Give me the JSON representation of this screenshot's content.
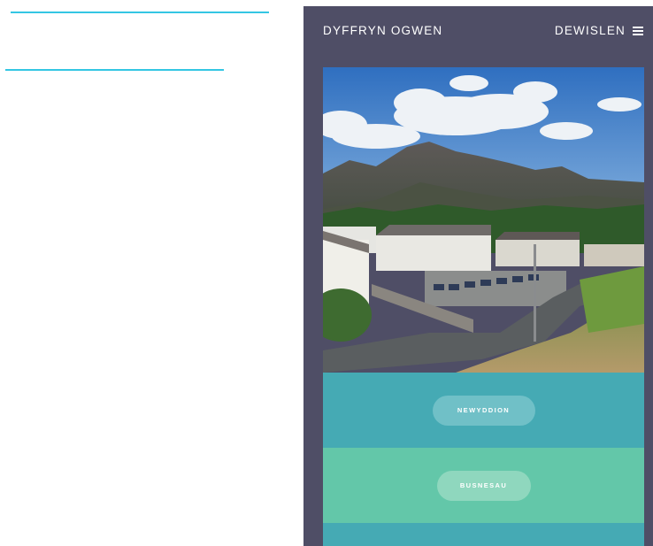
{
  "header": {
    "site_title": "DYFFRYN OGWEN",
    "menu_label": "DEWISLEN",
    "menu_icon": "hamburger-icon"
  },
  "hero": {
    "description_icon": "landscape-photo"
  },
  "sections": [
    {
      "button_label": "NEWYDDION",
      "color": "#45aab4"
    },
    {
      "button_label": "BUSNESAU",
      "color": "#63c7a9"
    }
  ],
  "colors": {
    "rule": "#34c6e3",
    "app_background": "#4f4e66",
    "teal": "#45aab4",
    "mint": "#63c7a9"
  }
}
